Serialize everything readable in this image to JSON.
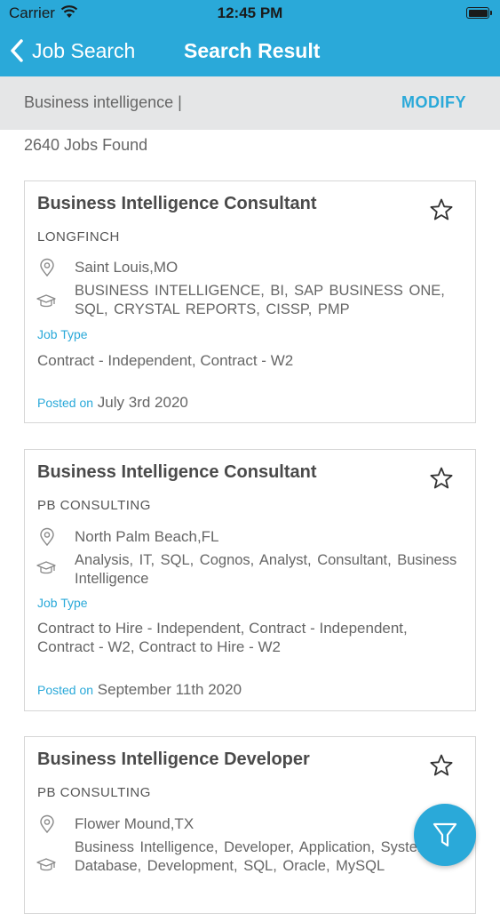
{
  "status_bar": {
    "carrier": "Carrier",
    "time": "12:45 PM"
  },
  "nav": {
    "back_label": "Job Search",
    "title": "Search Result"
  },
  "search": {
    "query": "Business intelligence |",
    "modify_label": "MODIFY"
  },
  "results": {
    "count_text": "2640 Jobs Found"
  },
  "jobs": [
    {
      "title": "Business Intelligence Consultant",
      "company": "LONGFINCH",
      "location": "Saint Louis,MO",
      "skills": "BUSINESS INTELLIGENCE,  BI,  SAP BUSINESS ONE,  SQL,  CRYSTAL REPORTS,  CISSP,  PMP",
      "job_type_label": "Job Type",
      "job_type": "Contract - Independent, Contract - W2",
      "posted_label": "Posted on",
      "posted_date": "July 3rd 2020"
    },
    {
      "title": "Business Intelligence Consultant",
      "company": "PB CONSULTING",
      "location": "North Palm Beach,FL",
      "skills": "Analysis,  IT,  SQL,  Cognos,  Analyst,  Consultant,  Business Intelligence",
      "job_type_label": "Job Type",
      "job_type": "Contract to Hire - Independent, Contract - Independent, Contract - W2, Contract to Hire - W2",
      "posted_label": "Posted on",
      "posted_date": "September 11th 2020"
    },
    {
      "title": "Business Intelligence Developer",
      "company": "PB CONSULTING",
      "location": "Flower Mound,TX",
      "skills": "Business Intelligence,  Developer,  Application,  System,  Database,  Development,  SQL,  Oracle,  MySQL"
    }
  ],
  "icons": {
    "back": "chevron-left-icon",
    "star": "star-outline-icon",
    "location": "map-pin-icon",
    "skills": "graduation-cap-icon",
    "filter": "filter-icon"
  },
  "colors": {
    "accent": "#2aa9d9",
    "search_bg": "#e5e6e7"
  }
}
